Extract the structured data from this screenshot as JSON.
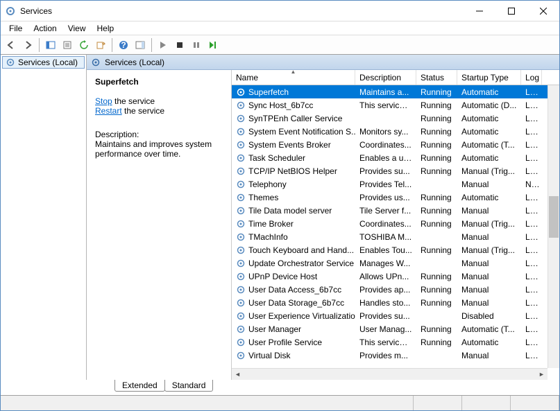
{
  "window": {
    "title": "Services"
  },
  "menu": {
    "file": "File",
    "action": "Action",
    "view": "View",
    "help": "Help"
  },
  "tree": {
    "root": "Services (Local)"
  },
  "panel": {
    "header": "Services (Local)"
  },
  "info": {
    "selected_name": "Superfetch",
    "stop_link": "Stop",
    "stop_suffix": " the service",
    "restart_link": "Restart",
    "restart_suffix": " the service",
    "desc_label": "Description:",
    "desc_text": "Maintains and improves system performance over time."
  },
  "columns": {
    "name": "Name",
    "description": "Description",
    "status": "Status",
    "startup": "Startup Type",
    "logon": "Log"
  },
  "tabs": {
    "extended": "Extended",
    "standard": "Standard"
  },
  "services": [
    {
      "name": "Superfetch",
      "desc": "Maintains a...",
      "status": "Running",
      "startup": "Automatic",
      "logon": "Loc",
      "selected": true
    },
    {
      "name": "Sync Host_6b7cc",
      "desc": "This service ...",
      "status": "Running",
      "startup": "Automatic (D...",
      "logon": "Loc"
    },
    {
      "name": "SynTPEnh Caller Service",
      "desc": "",
      "status": "Running",
      "startup": "Automatic",
      "logon": "Loc"
    },
    {
      "name": "System Event Notification S...",
      "desc": "Monitors sy...",
      "status": "Running",
      "startup": "Automatic",
      "logon": "Loc"
    },
    {
      "name": "System Events Broker",
      "desc": "Coordinates...",
      "status": "Running",
      "startup": "Automatic (T...",
      "logon": "Loc"
    },
    {
      "name": "Task Scheduler",
      "desc": "Enables a us...",
      "status": "Running",
      "startup": "Automatic",
      "logon": "Loc"
    },
    {
      "name": "TCP/IP NetBIOS Helper",
      "desc": "Provides su...",
      "status": "Running",
      "startup": "Manual (Trig...",
      "logon": "Loc"
    },
    {
      "name": "Telephony",
      "desc": "Provides Tel...",
      "status": "",
      "startup": "Manual",
      "logon": "Net"
    },
    {
      "name": "Themes",
      "desc": "Provides us...",
      "status": "Running",
      "startup": "Automatic",
      "logon": "Loc"
    },
    {
      "name": "Tile Data model server",
      "desc": "Tile Server f...",
      "status": "Running",
      "startup": "Manual",
      "logon": "Loc"
    },
    {
      "name": "Time Broker",
      "desc": "Coordinates...",
      "status": "Running",
      "startup": "Manual (Trig...",
      "logon": "Loc"
    },
    {
      "name": "TMachInfo",
      "desc": "TOSHIBA M...",
      "status": "",
      "startup": "Manual",
      "logon": "Loc"
    },
    {
      "name": "Touch Keyboard and Hand...",
      "desc": "Enables Tou...",
      "status": "Running",
      "startup": "Manual (Trig...",
      "logon": "Loc"
    },
    {
      "name": "Update Orchestrator Service",
      "desc": "Manages W...",
      "status": "",
      "startup": "Manual",
      "logon": "Loc"
    },
    {
      "name": "UPnP Device Host",
      "desc": "Allows UPn...",
      "status": "Running",
      "startup": "Manual",
      "logon": "Loc"
    },
    {
      "name": "User Data Access_6b7cc",
      "desc": "Provides ap...",
      "status": "Running",
      "startup": "Manual",
      "logon": "Loc"
    },
    {
      "name": "User Data Storage_6b7cc",
      "desc": "Handles sto...",
      "status": "Running",
      "startup": "Manual",
      "logon": "Loc"
    },
    {
      "name": "User Experience Virtualizatio...",
      "desc": "Provides su...",
      "status": "",
      "startup": "Disabled",
      "logon": "Loc"
    },
    {
      "name": "User Manager",
      "desc": "User Manag...",
      "status": "Running",
      "startup": "Automatic (T...",
      "logon": "Loc"
    },
    {
      "name": "User Profile Service",
      "desc": "This service ...",
      "status": "Running",
      "startup": "Automatic",
      "logon": "Loc"
    },
    {
      "name": "Virtual Disk",
      "desc": "Provides m...",
      "status": "",
      "startup": "Manual",
      "logon": "Loc"
    }
  ]
}
